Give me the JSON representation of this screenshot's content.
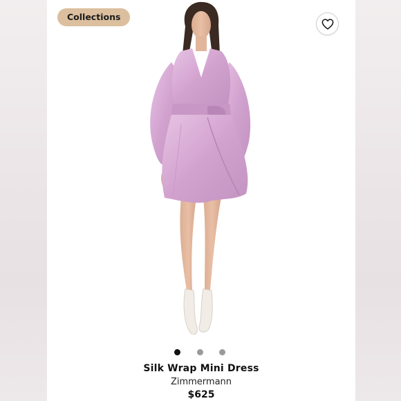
{
  "header": {
    "collections_label": "Collections",
    "favorite_icon": "heart-outline-icon"
  },
  "gallery": {
    "total_images": 3,
    "active_index": 0
  },
  "product": {
    "name": "Silk Wrap Mini Dress",
    "brand": "Zimmermann",
    "price": "$625"
  },
  "colors": {
    "pill_bg": "#dbbf9e",
    "dress": "#d6a9d4",
    "active_dot": "#111111",
    "inactive_dot": "#9a9a9a"
  }
}
